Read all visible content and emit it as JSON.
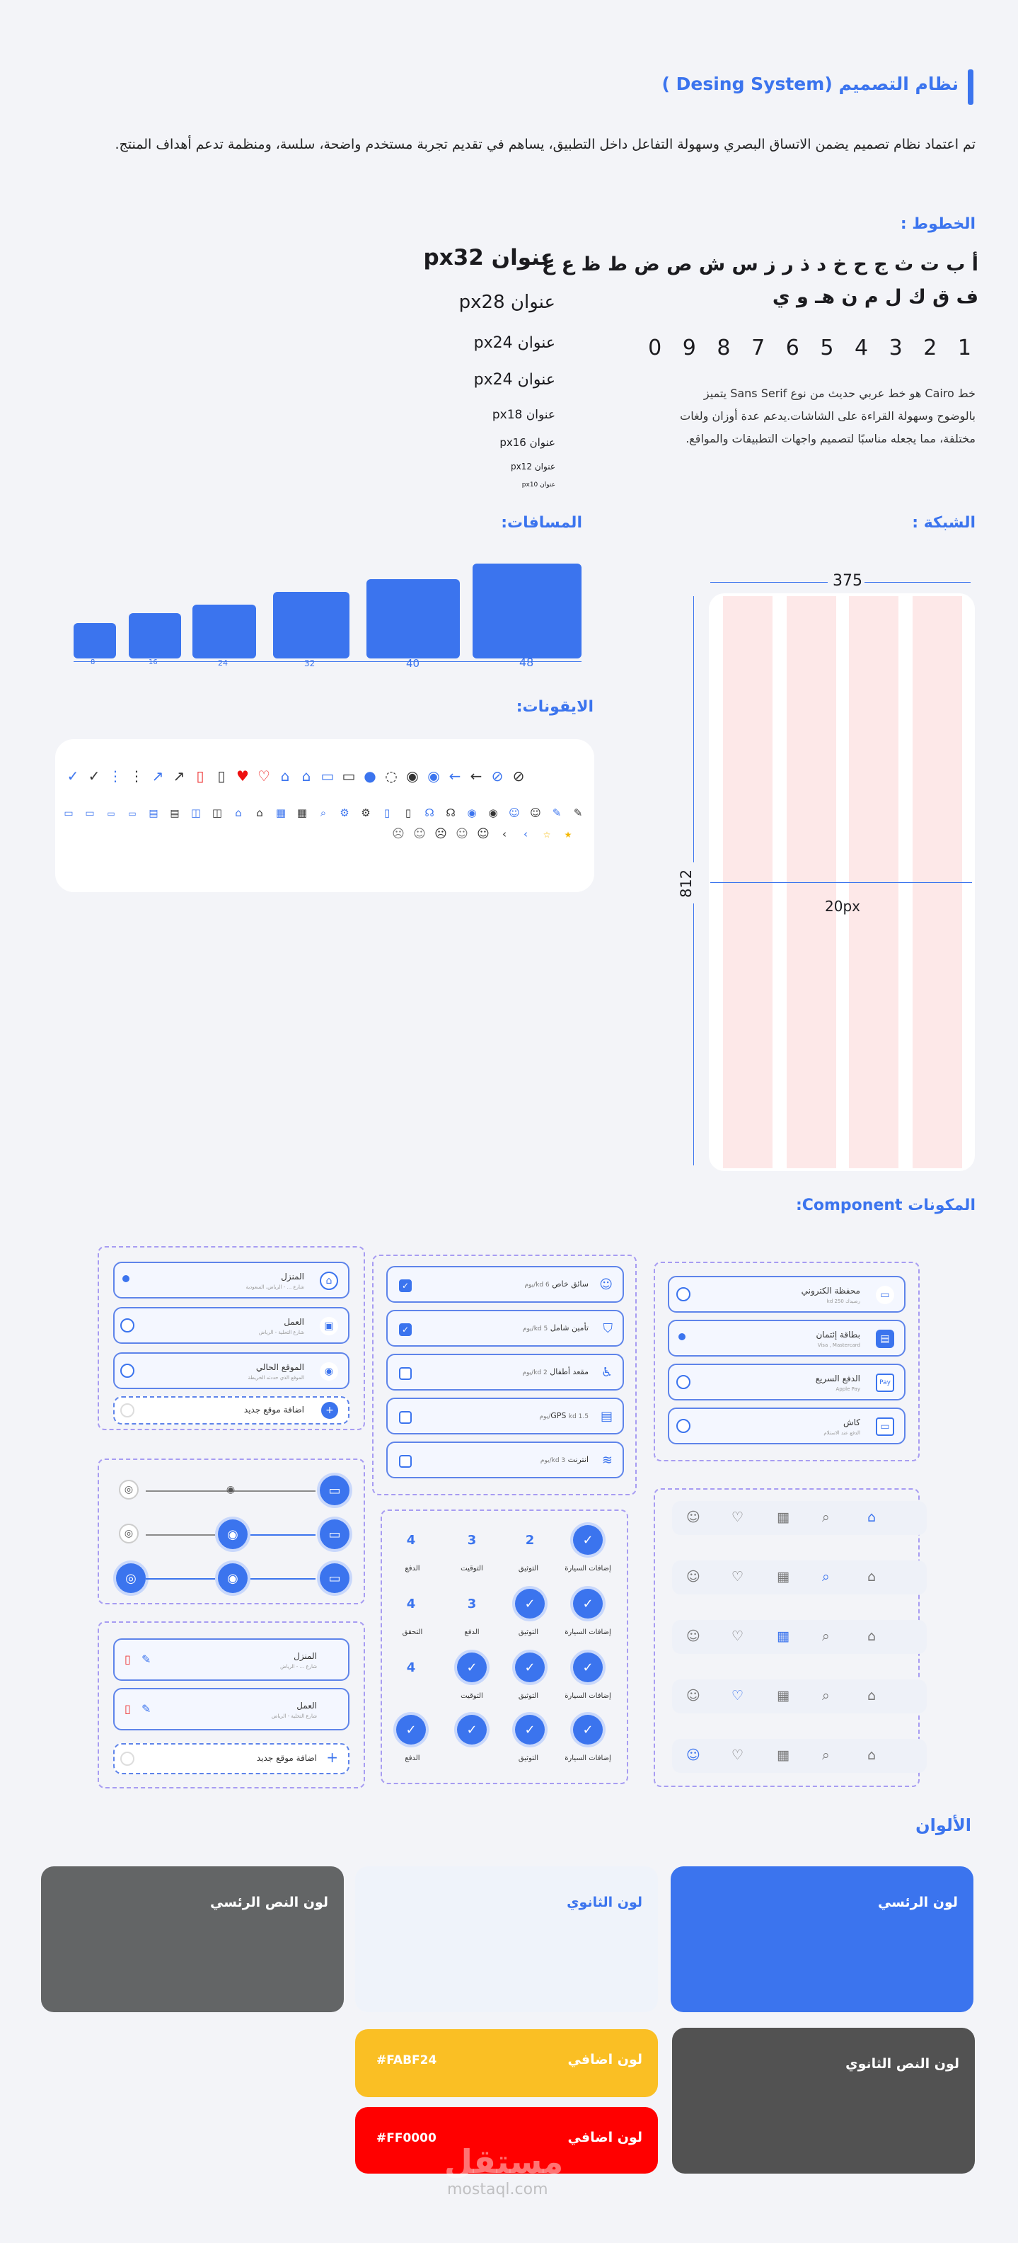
{
  "header": {
    "title": "نظام التصميم",
    "title_en": "(Desing System )",
    "intro": "تم اعتماد نظام تصميم يضمن الاتساق البصري وسهولة التفاعل داخل التطبيق، يساهم في تقديم تجربة مستخدم واضحة، سلسة، ومنظمة تدعم أهداف المنتج."
  },
  "fonts": {
    "heading": "الخطوط :",
    "letters_line1": "أ ب ت ث ج ح خ د ذ ر ز س ش ص ض ط ظ ع غ",
    "letters_line2": "ف ق ك ل م ن هـ و ي",
    "digits": "1 2 3 4 5 6 7 8 9 0",
    "description": "خط Cairo هو خط عربي حديث من نوع Sans Serif يتميز بالوضوح وسهولة القراءة على الشاشات.يدعم عدة أوزان ولغات مختلفة، مما يجعله مناسبًا لتصميم واجهات التطبيقات والمواقع.",
    "sizes": [
      {
        "label": "عنوان px32"
      },
      {
        "label": "عنوان px28"
      },
      {
        "label": "عنوان px24"
      },
      {
        "label": "عنوان px24"
      },
      {
        "label": "عنوان px18"
      },
      {
        "label": "عنوان px16"
      },
      {
        "label": "عنوان px12"
      },
      {
        "label": "عنوان px10"
      }
    ]
  },
  "spacing": {
    "heading": "المسافات:",
    "labels": [
      "8",
      "16",
      "24",
      "32",
      "40",
      "48"
    ]
  },
  "grid": {
    "heading": "الشبكة :",
    "width": "375",
    "height": "812",
    "gutter": "20px"
  },
  "icons": {
    "heading": "الايقونات:"
  },
  "components": {
    "heading": "المكونات Component:",
    "addresses": [
      {
        "title": "المنزل",
        "sub": "شارع ... - الرياض، السعودية"
      },
      {
        "title": "العمل",
        "sub": "شارع التحلية - الرياض"
      },
      {
        "title": "الموقع الحالي",
        "sub": "الموقع الذي حددته الخريطة"
      },
      {
        "title": "اضافة موقع جديد",
        "sub": ""
      }
    ],
    "services": [
      {
        "title": "سائق خاص",
        "price": "kd 6/يوم"
      },
      {
        "title": "تأمين شامل",
        "price": "kd 5/يوم"
      },
      {
        "title": "مقعد أطفال",
        "price": "kd 2/يوم"
      },
      {
        "title": "GPS",
        "price": "kd 1.5/يوم"
      },
      {
        "title": "انترنت",
        "price": "kd 3/يوم"
      }
    ],
    "payments": [
      {
        "title": "محفظة الكتروني",
        "sub": "رصيدك 250 kd"
      },
      {
        "title": "بطاقة إئتمان",
        "sub": "Visa , Mastercard"
      },
      {
        "title": "الدفع السريع",
        "sub": "Apple Pay"
      },
      {
        "title": "كاش",
        "sub": "الدفع عند الاستلام"
      }
    ],
    "saved": [
      {
        "title": "المنزل",
        "sub": "شارع ... - الرياض"
      },
      {
        "title": "العمل",
        "sub": "شارع التحلية - الرياض"
      },
      {
        "title": "اضافة موقع جديد",
        "sub": ""
      }
    ],
    "steps": {
      "labels": [
        "إضافات السيارة",
        "التوثيق",
        "التوقيت",
        "الدفع"
      ],
      "labels_alt": [
        "إضافات السيارة",
        "التوثيق",
        "الدفع",
        "التحقق"
      ],
      "numbers": [
        "2",
        "3",
        "4"
      ]
    }
  },
  "colors": {
    "heading": "الألوان",
    "primary": {
      "name": "لون الرئسي",
      "hex": "#3B74EE"
    },
    "secondary": {
      "name": "لون الثانوي",
      "hex": "#EFF3FA"
    },
    "text_primary": {
      "name": "لون النص الرئسي",
      "hex": "#636566"
    },
    "text_secondary": {
      "name": "لون النص الثانوي",
      "hex": "#525252"
    },
    "extra1": {
      "name": "لون اضافي",
      "hex": "#FABF24"
    },
    "extra2": {
      "name": "لون اضافي",
      "hex": "#FF0000"
    }
  },
  "watermark": {
    "ar": "مستقل",
    "en": "mostaql.com"
  }
}
